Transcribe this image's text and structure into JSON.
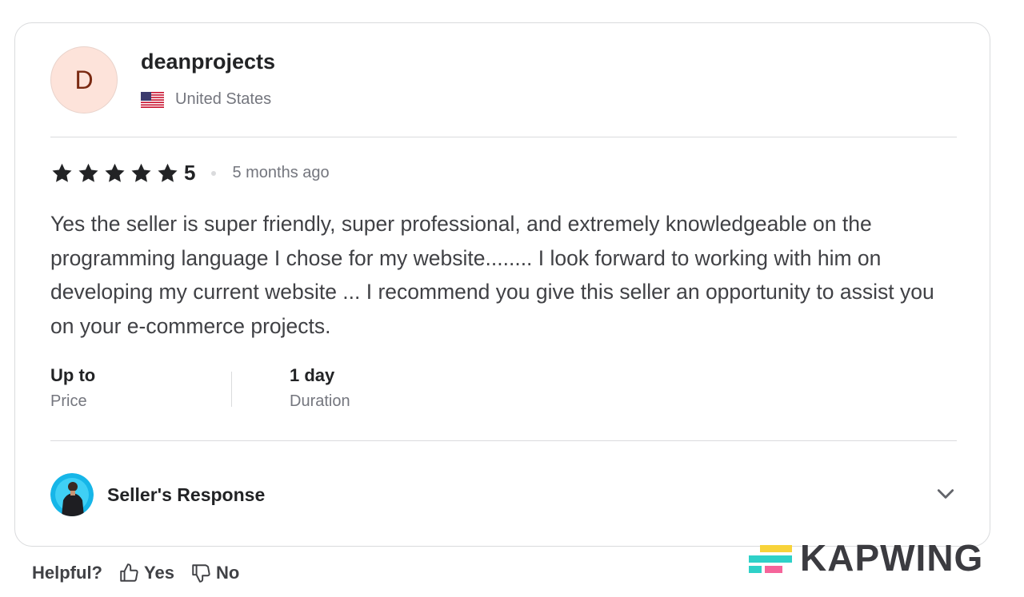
{
  "reviewer": {
    "avatar_letter": "D",
    "username": "deanprojects",
    "country": "United States",
    "flag_icon": "us-flag-icon"
  },
  "rating": {
    "stars": 5,
    "value_label": "5",
    "time_ago": "5 months ago",
    "star_color": "#222325"
  },
  "review": {
    "text": "Yes the seller is super friendly, super professional, and extremely knowledgeable on the programming language I chose for my website........ I look forward to working with him on developing my current website ... I recommend you give this seller an opportunity to assist you on your e-commerce projects."
  },
  "details": {
    "price_value": "Up to",
    "price_label": "Price",
    "duration_value": "1 day",
    "duration_label": "Duration"
  },
  "seller_response": {
    "label": "Seller's Response",
    "expand_icon": "chevron-down-icon"
  },
  "helpful": {
    "question": "Helpful?",
    "yes_label": "Yes",
    "no_label": "No"
  },
  "watermark": {
    "text": "KAPWING",
    "colors": [
      "#2ed1c8",
      "#f8d33a",
      "#f5649a"
    ]
  }
}
